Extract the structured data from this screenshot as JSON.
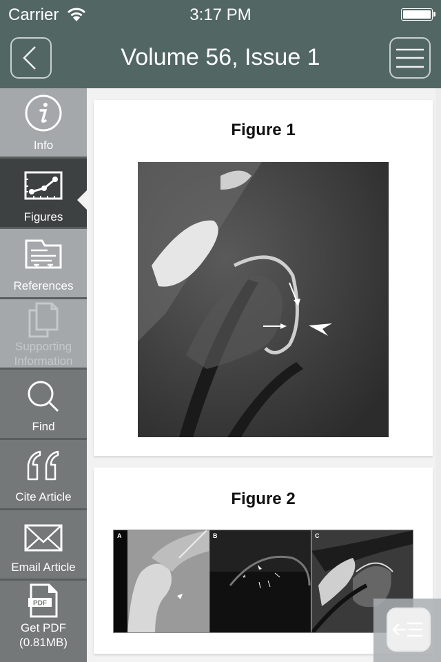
{
  "status_bar": {
    "carrier": "Carrier",
    "time": "3:17 PM",
    "wifi_icon": "wifi-icon",
    "battery_icon": "battery-icon"
  },
  "header": {
    "title": "Volume 56, Issue 1",
    "back_icon": "chevron-left-icon",
    "menu_icon": "hamburger-menu-icon",
    "background_color": "#526664"
  },
  "sidebar": {
    "active_index": 1,
    "items": [
      {
        "label": "Info",
        "icon": "info-icon",
        "enabled": true
      },
      {
        "label": "Figures",
        "icon": "line-chart-icon",
        "enabled": true
      },
      {
        "label": "References",
        "icon": "folder-icon",
        "enabled": true
      },
      {
        "label": "Supporting\nInformation",
        "label_line1": "Supporting",
        "label_line2": "Information",
        "icon": "documents-icon",
        "enabled": false
      },
      {
        "label": "Find",
        "icon": "search-icon",
        "enabled": true
      },
      {
        "label": "Cite Article",
        "icon": "quote-icon",
        "enabled": true
      },
      {
        "label": "Email Article",
        "icon": "envelope-icon",
        "enabled": true
      },
      {
        "label": "Get PDF (0.81MB)",
        "label_line1": "Get PDF",
        "label_line2": "(0.81MB)",
        "icon": "pdf-file-icon",
        "icon_text": "PDF",
        "enabled": true
      }
    ]
  },
  "figures": [
    {
      "title": "Figure 1",
      "image_alt": "MRI image of hip joint with arrows and arrowhead"
    },
    {
      "title": "Figure 2",
      "image_alt": "Three-panel figure: radiograph, ultrasound, MRI",
      "panels": [
        "A",
        "B",
        "C"
      ]
    }
  ],
  "floating_button": {
    "icon": "collapse-sidebar-icon"
  }
}
